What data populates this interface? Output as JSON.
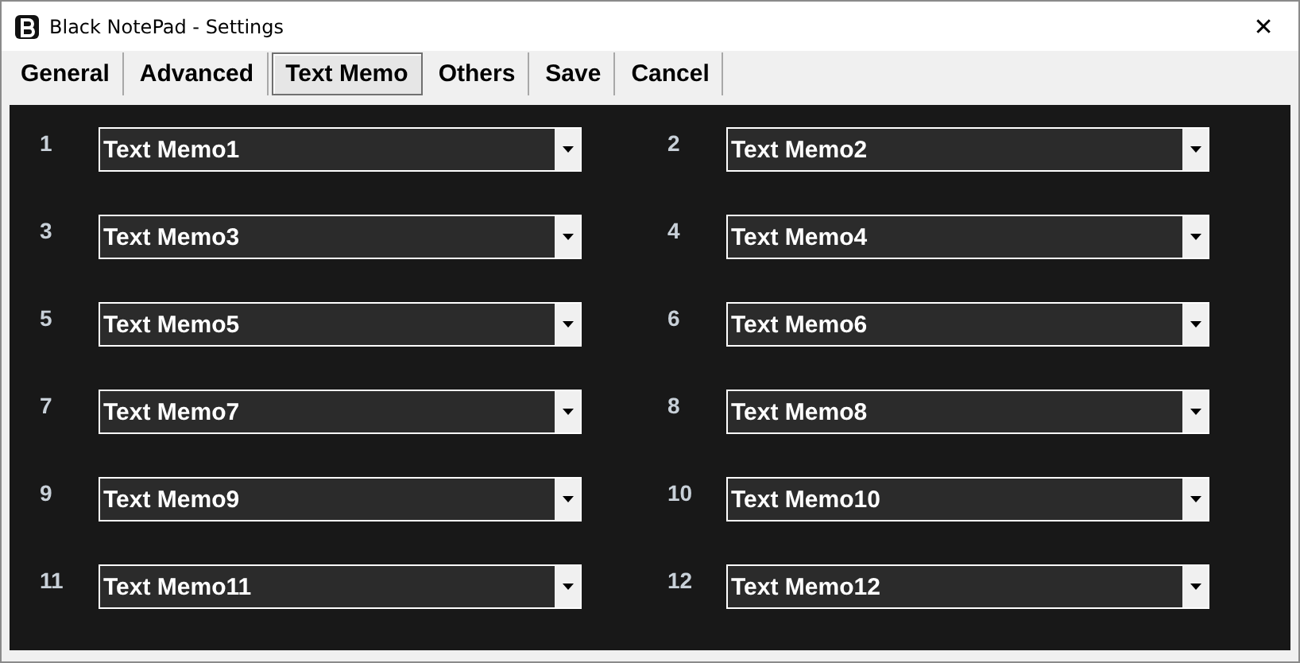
{
  "window": {
    "title": "Black NotePad - Settings",
    "close": "✕"
  },
  "tabs": [
    {
      "label": "General",
      "selected": false
    },
    {
      "label": "Advanced",
      "selected": false
    },
    {
      "label": "Text Memo",
      "selected": true
    },
    {
      "label": "Others",
      "selected": false
    },
    {
      "label": "Save",
      "selected": false
    },
    {
      "label": "Cancel",
      "selected": false
    }
  ],
  "memos": [
    {
      "number": "1",
      "value": "Text Memo1"
    },
    {
      "number": "2",
      "value": "Text Memo2"
    },
    {
      "number": "3",
      "value": "Text Memo3"
    },
    {
      "number": "4",
      "value": "Text Memo4"
    },
    {
      "number": "5",
      "value": "Text Memo5"
    },
    {
      "number": "6",
      "value": "Text Memo6"
    },
    {
      "number": "7",
      "value": "Text Memo7"
    },
    {
      "number": "8",
      "value": "Text Memo8"
    },
    {
      "number": "9",
      "value": "Text Memo9"
    },
    {
      "number": "10",
      "value": "Text Memo10"
    },
    {
      "number": "11",
      "value": "Text Memo11"
    },
    {
      "number": "12",
      "value": "Text Memo12"
    }
  ]
}
